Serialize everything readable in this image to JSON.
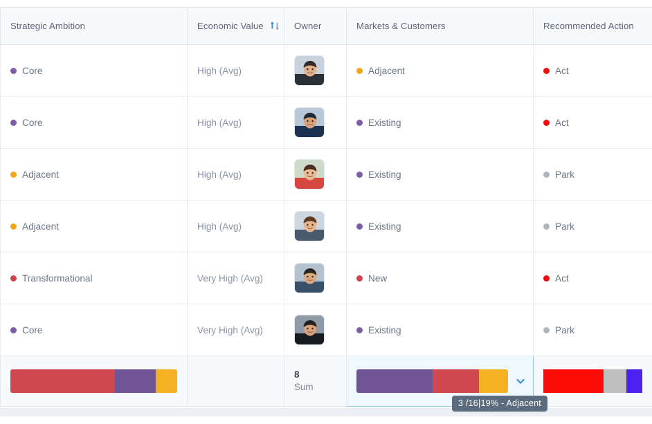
{
  "table": {
    "columns": [
      {
        "key": "ambition",
        "label": "Strategic Ambition",
        "sort_icon": ""
      },
      {
        "key": "economic",
        "label": "Economic Value",
        "sort_icon": "sort-asc-desc-icon"
      },
      {
        "key": "owner",
        "label": "Owner",
        "sort_icon": ""
      },
      {
        "key": "markets",
        "label": "Markets & Customers",
        "sort_icon": ""
      },
      {
        "key": "action",
        "label": "Recommended Action",
        "sort_icon": ""
      }
    ],
    "rows": [
      {
        "ambition": {
          "label": "Core",
          "color": "#7b5ea7"
        },
        "economic": "High (Avg)",
        "owner": {
          "icon": "avatar",
          "skin": "#e2b08a",
          "hair": "#2f2a28",
          "shirt": "#2b2f36",
          "bg": "#c8d2dc"
        },
        "markets": {
          "label": "Adjacent",
          "color": "#f2a815"
        },
        "action": {
          "label": "Act",
          "color": "#f20d0d"
        }
      },
      {
        "ambition": {
          "label": "Core",
          "color": "#7b5ea7"
        },
        "economic": "High (Avg)",
        "owner": {
          "icon": "avatar",
          "skin": "#d9a279",
          "hair": "#1e2630",
          "shirt": "#1b3350",
          "bg": "#b9c8d8"
        },
        "markets": {
          "label": "Existing",
          "color": "#7b5ea7"
        },
        "action": {
          "label": "Act",
          "color": "#f20d0d"
        }
      },
      {
        "ambition": {
          "label": "Adjacent",
          "color": "#f2a815"
        },
        "economic": "High (Avg)",
        "owner": {
          "icon": "avatar",
          "skin": "#e8bb96",
          "hair": "#4a2c1c",
          "shirt": "#d6483f",
          "bg": "#cfd9c8"
        },
        "markets": {
          "label": "Existing",
          "color": "#7b5ea7"
        },
        "action": {
          "label": "Park",
          "color": "#b0b6bf"
        }
      },
      {
        "ambition": {
          "label": "Adjacent",
          "color": "#f2a815"
        },
        "economic": "High (Avg)",
        "owner": {
          "icon": "avatar",
          "skin": "#e6b58e",
          "hair": "#5a3a22",
          "shirt": "#4a5a6e",
          "bg": "#cdd6de"
        },
        "markets": {
          "label": "Existing",
          "color": "#7b5ea7"
        },
        "action": {
          "label": "Park",
          "color": "#b0b6bf"
        }
      },
      {
        "ambition": {
          "label": "Transformational",
          "color": "#d1424f"
        },
        "economic": "Very High (Avg)",
        "owner": {
          "icon": "avatar",
          "skin": "#ddaa82",
          "hair": "#2a2521",
          "shirt": "#39506b",
          "bg": "#b5c2d0"
        },
        "markets": {
          "label": "New",
          "color": "#d1424f"
        },
        "action": {
          "label": "Act",
          "color": "#f20d0d"
        }
      },
      {
        "ambition": {
          "label": "Core",
          "color": "#7b5ea7"
        },
        "economic": "Very High (Avg)",
        "owner": {
          "icon": "avatar",
          "skin": "#d7a27c",
          "hair": "#26211e",
          "shirt": "#171a1f",
          "bg": "#8e9aa6"
        },
        "markets": {
          "label": "Existing",
          "color": "#7b5ea7"
        },
        "action": {
          "label": "Park",
          "color": "#b0b6bf"
        }
      }
    ],
    "summary": {
      "ambition_bar": {
        "name": "strategic-ambition-summary-bar",
        "segments": [
          {
            "label": "Transformational",
            "color": "#d1484f",
            "pct": 62.5
          },
          {
            "label": "Core",
            "color": "#6f5596",
            "pct": 24.5
          },
          {
            "label": "Adjacent",
            "color": "#f4b223",
            "pct": 13.0
          }
        ]
      },
      "economic_value": "",
      "owner": {
        "value": "8",
        "label": "Sum"
      },
      "markets_bar": {
        "name": "markets-customers-summary-bar",
        "selected": true,
        "segments": [
          {
            "label": "Existing",
            "color": "#6f5596",
            "pct": 50.0
          },
          {
            "label": "New",
            "color": "#d1484f",
            "pct": 31.0
          },
          {
            "label": "Adjacent",
            "color": "#f4b223",
            "pct": 19.0
          }
        ]
      },
      "action_bar": {
        "name": "recommended-action-summary-bar",
        "segments": [
          {
            "label": "Act",
            "color": "#fb0c06",
            "pct": 61.0
          },
          {
            "label": "Park",
            "color": "#bfbfbf",
            "pct": 23.0
          },
          {
            "label": "Other",
            "color": "#4d20f0",
            "pct": 16.0
          }
        ]
      }
    }
  },
  "tooltip": {
    "text": "3 /16|19% - Adjacent"
  }
}
